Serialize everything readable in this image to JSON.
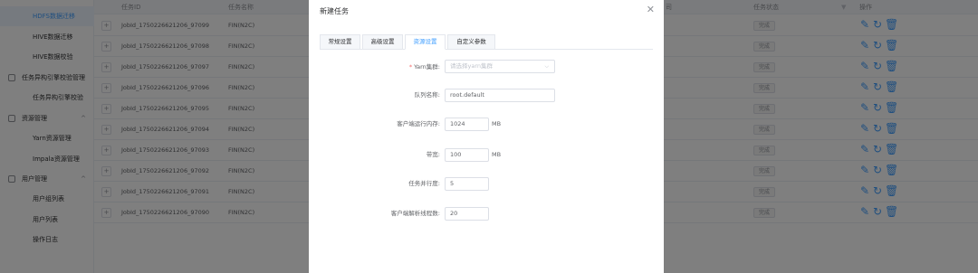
{
  "sidebar": {
    "items": [
      {
        "label": "HDFS数据迁移"
      },
      {
        "label": "HIVE数据迁移"
      },
      {
        "label": "HIVE数据校验"
      },
      {
        "label": "任务异构引擎校验管理"
      },
      {
        "label": "任务异构引擎校验"
      },
      {
        "label": "资源管理"
      },
      {
        "label": "Yarn资源管理"
      },
      {
        "label": "Impala资源管理"
      },
      {
        "label": "用户管理"
      },
      {
        "label": "用户组列表"
      },
      {
        "label": "用户列表"
      },
      {
        "label": "操作日志"
      }
    ],
    "caret_up": "^"
  },
  "table": {
    "headers": {
      "task_id": "任务ID",
      "task_name": "任务名称",
      "time_partial": "司",
      "status": "任务状态",
      "actions": "操作"
    },
    "expand_symbol": "+",
    "rows": [
      {
        "id": "JobId_1750226621206_97099",
        "name": "FIN(N2C)",
        "status": "完成"
      },
      {
        "id": "JobId_1750226621206_97098",
        "name": "FIN(N2C)",
        "status": "完成"
      },
      {
        "id": "JobId_1750226621206_97097",
        "name": "FIN(N2C)",
        "status": "完成"
      },
      {
        "id": "JobId_1750226621206_97096",
        "name": "FIN(N2C)",
        "status": "完成"
      },
      {
        "id": "JobId_1750226621206_97095",
        "name": "FIN(N2C)",
        "status": "完成"
      },
      {
        "id": "JobId_1750226621206_97094",
        "name": "FIN(N2C)",
        "status": "完成"
      },
      {
        "id": "JobId_1750226621206_97093",
        "name": "FIN(N2C)",
        "status": "完成"
      },
      {
        "id": "JobId_1750226621206_97092",
        "name": "FIN(N2C)",
        "status": "完成"
      },
      {
        "id": "JobId_1750226621206_97091",
        "name": "FIN(N2C)",
        "status": "完成"
      },
      {
        "id": "JobId_1750226621206_97090",
        "name": "FIN(N2C)",
        "status": "完成"
      }
    ],
    "icons": {
      "edit": "edit-icon",
      "refresh": "refresh-icon",
      "delete": "delete-icon",
      "filter": "filter-icon"
    }
  },
  "dialog": {
    "title": "新建任务",
    "close": "✕",
    "tabs": [
      {
        "label": "常规设置"
      },
      {
        "label": "高级设置"
      },
      {
        "label": "资源设置"
      },
      {
        "label": "自定义参数"
      }
    ],
    "active_tab": "资源设置",
    "form": {
      "yarn_label": "Yarn集群:",
      "yarn_placeholder": "请选择yarn集群",
      "queue_label": "队列名称:",
      "queue_value": "root.default",
      "memory_label": "客户端运行内存:",
      "memory_value": "1024",
      "memory_unit": "MB",
      "bandwidth_label": "带宽:",
      "bandwidth_value": "100",
      "bandwidth_unit": "MB",
      "parallel_label": "任务并行度:",
      "parallel_value": "5",
      "threads_label": "客户端解析线程数:",
      "threads_value": "20"
    }
  },
  "colors": {
    "accent": "#409eff",
    "mask": "rgba(0,0,0,0.5)"
  }
}
